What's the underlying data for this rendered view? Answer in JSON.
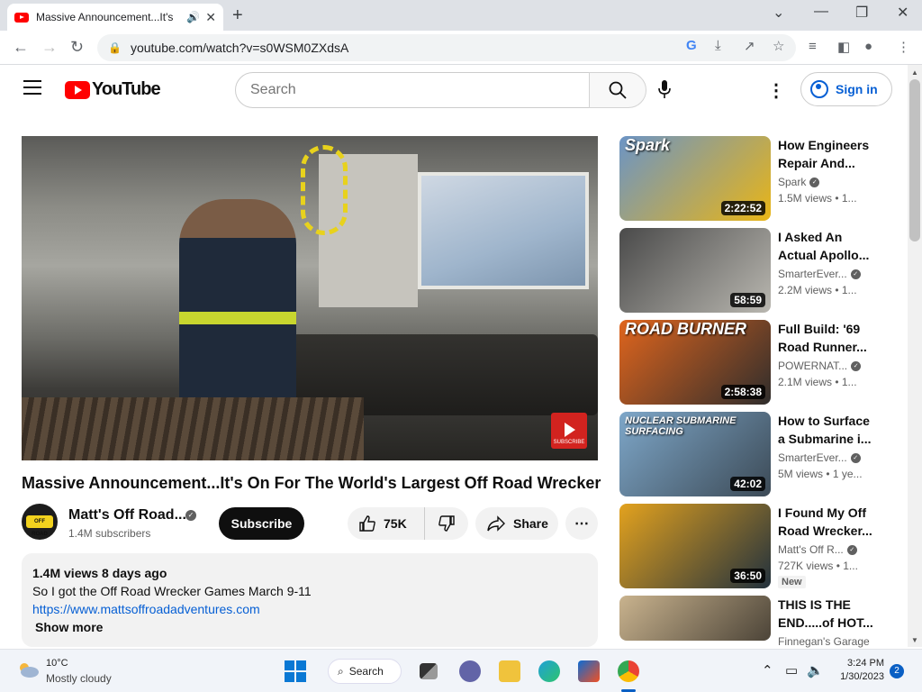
{
  "browser": {
    "tab_title": "Massive Announcement...It's",
    "url": "youtube.com/watch?v=s0WSM0ZXdsA"
  },
  "header": {
    "logo_text": "YouTube",
    "search_placeholder": "Search",
    "signin_label": "Sign in"
  },
  "video": {
    "title": "Massive Announcement...It's On For The World's Largest Off Road Wrecker",
    "channel_name": "Matt's Off Road...",
    "channel_avatar_text": "OFF ROAD",
    "subscribers": "1.4M subscribers",
    "subscribe_label": "Subscribe",
    "likes": "75K",
    "share_label": "Share",
    "watermark_text": "SUBSCRIBE"
  },
  "description": {
    "stats": "1.4M views  8 days ago",
    "text": "So I got the Off Road Wrecker Games March 9-11",
    "link": "https://www.mattsoffroadadventures.com",
    "show_more": "Show more"
  },
  "related": [
    {
      "title": "How Engineers Repair And...",
      "channel": "Spark",
      "meta": "1.5M views • 1...",
      "duration": "2:22:52",
      "thumb_text": "Spark",
      "badge": "",
      "colors": [
        "#6b94c6",
        "#e9b516"
      ]
    },
    {
      "title": "I Asked An Actual Apollo...",
      "channel": "SmarterEver...",
      "meta": "2.2M views • 1...",
      "duration": "58:59",
      "thumb_text": "",
      "badge": "",
      "colors": [
        "#4a4a4a",
        "#b9b7b0"
      ]
    },
    {
      "title": "Full Build: '69 Road Runner...",
      "channel": "POWERNAT...",
      "meta": "2.1M views • 1...",
      "duration": "2:58:38",
      "thumb_text": "ROAD BURNER",
      "badge": "",
      "colors": [
        "#e0651d",
        "#2f2d2c"
      ]
    },
    {
      "title": "How to Surface a Submarine i...",
      "channel": "SmarterEver...",
      "meta": "5M views • 1 ye...",
      "duration": "42:02",
      "thumb_text": "NUCLEAR SUBMARINE SURFACING",
      "badge": "",
      "colors": [
        "#7ea7c9",
        "#3c4a56"
      ]
    },
    {
      "title": "I Found My Off Road Wrecker...",
      "channel": "Matt's Off R...",
      "meta": "727K views • 1...",
      "duration": "36:50",
      "thumb_text": "",
      "badge": "New",
      "colors": [
        "#e3a21e",
        "#22313d"
      ]
    },
    {
      "title": "THIS IS THE END.....of HOT...",
      "channel": "Finnegan's Garage",
      "meta": "",
      "duration": "",
      "thumb_text": "",
      "badge": "",
      "colors": [
        "#c9b38e",
        "#4c4438"
      ]
    }
  ],
  "taskbar": {
    "temp": "10°C",
    "weather": "Mostly cloudy",
    "search_label": "Search",
    "time": "3:24 PM",
    "date": "1/30/2023",
    "notifications": "2"
  }
}
